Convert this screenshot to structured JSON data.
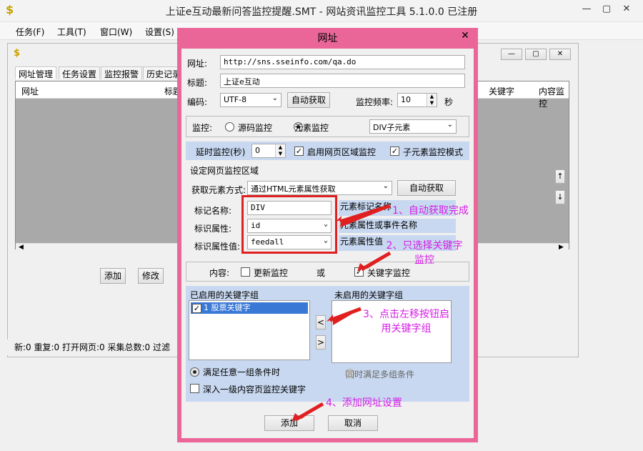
{
  "app": {
    "title": "上证e互动最新问答监控提醒.SMT - 网站资讯监控工具 5.1.0.0 已注册",
    "menus": [
      "任务(F)",
      "工具(T)",
      "窗口(W)",
      "设置(S)"
    ]
  },
  "main": {
    "tabs": [
      "网址管理",
      "任务设置",
      "监控报警",
      "历史记录"
    ],
    "columns": {
      "url": "网址",
      "mark": "标题",
      "keyword": "关键字",
      "content": "内容监控"
    },
    "add_label": "添加",
    "edit_label": "修改",
    "status": "新:0  重复:0  打开网页:0  采集总数:0  过滤"
  },
  "dialog": {
    "title": "网址",
    "url_label": "网址:",
    "url_value": "http://sns.sseinfo.com/qa.do",
    "title_label": "标题:",
    "title_value": "上证e互动",
    "encoding_label": "编码:",
    "encoding_value": "UTF-8",
    "auto_detect_label": "自动获取",
    "freq_label": "监控频率:",
    "freq_value": "10",
    "freq_unit": "秒",
    "monitor_label": "监控:",
    "source_monitor_label": "源码监控",
    "element_monitor_label": "元素监控",
    "element_mode_value": "DIV子元素",
    "delay_label": "延时监控(秒)",
    "delay_value": "0",
    "region_enable_label": "启用网页区域监控",
    "child_mode_label": "子元素监控模式",
    "region_section_title": "设定网页监控区域",
    "fetch_method_label": "获取元素方式:",
    "fetch_method_value": "通过HTML元素属性获取",
    "fetch_auto_label": "自动获取",
    "tag_name_label": "标记名称:",
    "tag_name_value": "DIV",
    "attr_label": "标识属性:",
    "attr_value": "id",
    "attr_value_label": "标识属性值:",
    "attr_value_value": "feedall",
    "hint_tag": "元素标记名称",
    "hint_attr": "元素属性或事件名称",
    "hint_value": "元素属性值",
    "content_label": "内容:",
    "update_monitor_label": "更新监控",
    "or_label": "或",
    "keyword_monitor_label": "关键字监控",
    "enabled_groups_label": "已启用的关键字组",
    "enabled_group_item": "1 股票关键字",
    "disabled_groups_label": "未启用的关键字组",
    "move_left": "<",
    "move_right": ">",
    "any_group_label": "满足任意一组条件时",
    "all_groups_label": "同时满足多组条件",
    "deep_label": "深入一级内容页监控关键字",
    "add_label": "添加",
    "cancel_label": "取消"
  },
  "annotations": {
    "note1": "1、自动获取完成",
    "note2": "2、只选择关键字监控",
    "note3": "3、点击左移按钮启用关键字组",
    "note4": "4、添加网址设置"
  }
}
